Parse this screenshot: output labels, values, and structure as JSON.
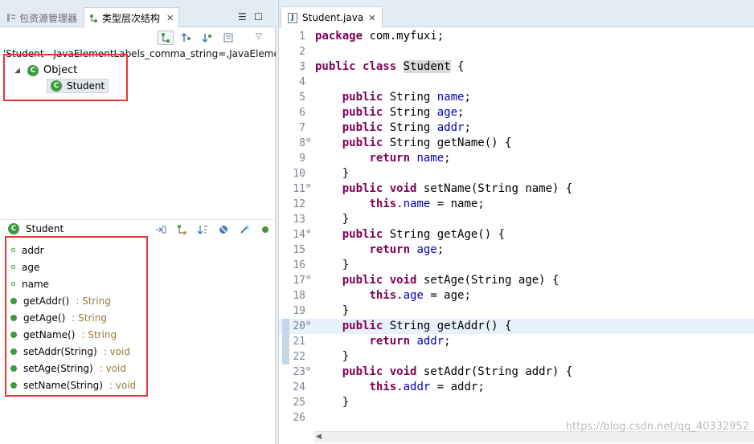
{
  "left": {
    "tabs": [
      {
        "label": "包资源管理器"
      },
      {
        "label": "类型层次结构"
      }
    ],
    "hierarchy_path": "'Student - JavaElementLabels_comma_string=,JavaElement",
    "tree": [
      {
        "label": "Object"
      },
      {
        "label": "Student"
      }
    ],
    "member_header": "Student",
    "members": [
      {
        "name": "addr",
        "ret": ""
      },
      {
        "name": "age",
        "ret": ""
      },
      {
        "name": "name",
        "ret": ""
      },
      {
        "name": "getAddr()",
        "ret": " : String"
      },
      {
        "name": "getAge()",
        "ret": " : String"
      },
      {
        "name": "getName()",
        "ret": " : String"
      },
      {
        "name": "setAddr(String)",
        "ret": " : void"
      },
      {
        "name": "setAge(String)",
        "ret": " : void"
      },
      {
        "name": "setName(String)",
        "ret": " : void"
      }
    ]
  },
  "editor": {
    "tab_label": "Student.java",
    "watermark": "https://blog.csdn.net/qq_40332952"
  },
  "code": [
    {
      "n": "1",
      "t": "package com.myfuxi;"
    },
    {
      "n": "2",
      "t": ""
    },
    {
      "n": "3",
      "t": "public class Student {"
    },
    {
      "n": "4",
      "t": ""
    },
    {
      "n": "5",
      "t": "    public String name;"
    },
    {
      "n": "6",
      "t": "    public String age;"
    },
    {
      "n": "7",
      "t": "    public String addr;"
    },
    {
      "n": "8",
      "t": "    public String getName() {"
    },
    {
      "n": "9",
      "t": "        return name;"
    },
    {
      "n": "10",
      "t": "    }"
    },
    {
      "n": "11",
      "t": "    public void setName(String name) {"
    },
    {
      "n": "12",
      "t": "        this.name = name;"
    },
    {
      "n": "13",
      "t": "    }"
    },
    {
      "n": "14",
      "t": "    public String getAge() {"
    },
    {
      "n": "15",
      "t": "        return age;"
    },
    {
      "n": "16",
      "t": "    }"
    },
    {
      "n": "17",
      "t": "    public void setAge(String age) {"
    },
    {
      "n": "18",
      "t": "        this.age = age;"
    },
    {
      "n": "19",
      "t": "    }"
    },
    {
      "n": "20",
      "t": "    public String getAddr() {"
    },
    {
      "n": "21",
      "t": "        return addr;"
    },
    {
      "n": "22",
      "t": "    }"
    },
    {
      "n": "23",
      "t": "    public void setAddr(String addr) {"
    },
    {
      "n": "24",
      "t": "        this.addr = addr;"
    },
    {
      "n": "25",
      "t": "    }"
    },
    {
      "n": "26",
      "t": ""
    }
  ]
}
